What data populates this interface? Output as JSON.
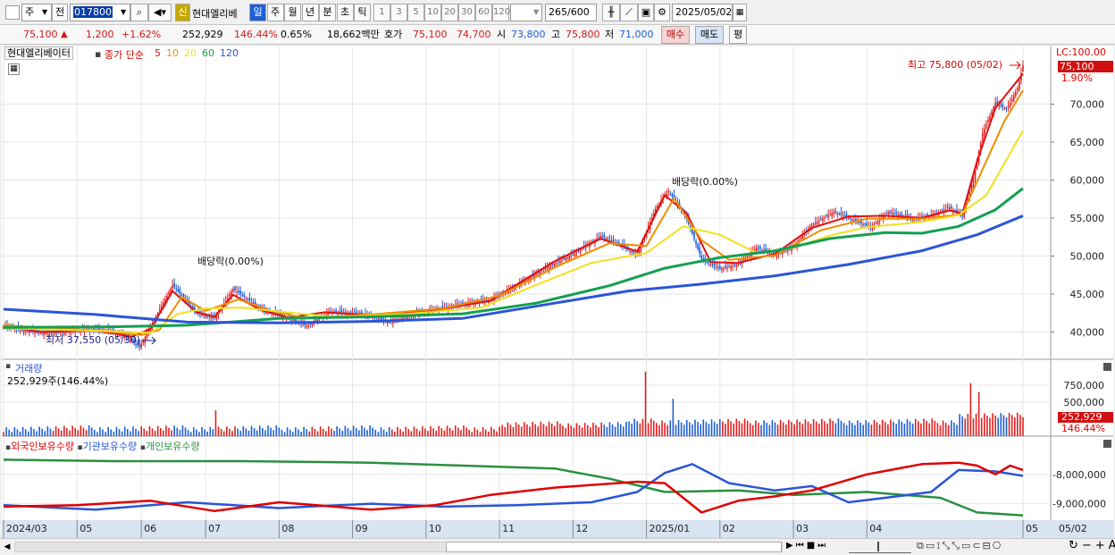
{
  "toolbar": {
    "period_type": "주",
    "prev_label": "전",
    "stock_code": "017800",
    "new_badge": "신",
    "stock_name": "현대엘리베",
    "intervals": [
      "일",
      "주",
      "월",
      "년",
      "분",
      "초",
      "틱"
    ],
    "active_interval": "일",
    "minute_options": [
      "1",
      "3",
      "5",
      "10",
      "20",
      "30",
      "60",
      "120"
    ],
    "count_value": "265",
    "count_total": "/600",
    "date_value": "2025/05/02"
  },
  "quote": {
    "price": "75,100",
    "change": "1,200",
    "change_pct": "+1.62%",
    "volume": "252,929",
    "volume_ratio": "146.44%",
    "turnover_pct": "0.65%",
    "amount": "18,662백만",
    "ask_label": "호가",
    "ask": "75,100",
    "bid": "74,700",
    "open_label": "시",
    "open": "73,800",
    "high_label": "고",
    "high": "75,800",
    "low_label": "저",
    "low": "71,000",
    "buy_label": "매수",
    "sell_label": "매도",
    "avg_label": "평"
  },
  "colors": {
    "up": "#e02020",
    "down": "#1f5fd6",
    "ma5": "#e01010",
    "ma10": "#f08c00",
    "ma20": "#f0e020",
    "ma60": "#14a050",
    "ma120": "#2a55d8",
    "foreign": "#e00000",
    "inst": "#2a55d8",
    "indiv": "#2a9040"
  },
  "chart_data": [
    {
      "type": "candlestick",
      "title": "현대엘리베이터",
      "legend_title": "종가 단순",
      "legend": [
        "5",
        "10",
        "20",
        "60",
        "120"
      ],
      "lc_label": "LC:100.00",
      "y_ticks": [
        "40,000",
        "45,000",
        "50,000",
        "55,000",
        "60,000",
        "65,000",
        "70,000"
      ],
      "ylim": [
        37000,
        77000
      ],
      "current_price": "75,100",
      "current_pct": "1.90%",
      "annotations": [
        {
          "text": "최고 75,800 (05/02)",
          "value": 75800
        },
        {
          "text": "최저 37,550 (05/30)",
          "value": 37550
        },
        {
          "text": "배당락(0.00%)"
        },
        {
          "text": "배당락(0.00%)"
        }
      ],
      "price_path": [
        [
          0,
          40800
        ],
        [
          10,
          40200
        ],
        [
          25,
          39800
        ],
        [
          45,
          40300
        ],
        [
          58,
          40200
        ],
        [
          68,
          39200
        ],
        [
          74,
          38000
        ],
        [
          80,
          40600
        ],
        [
          92,
          46200
        ],
        [
          105,
          42500
        ],
        [
          115,
          41800
        ],
        [
          125,
          45700
        ],
        [
          140,
          43000
        ],
        [
          155,
          41800
        ],
        [
          165,
          40800
        ],
        [
          178,
          42700
        ],
        [
          195,
          42400
        ],
        [
          210,
          41300
        ],
        [
          225,
          42400
        ],
        [
          245,
          43500
        ],
        [
          265,
          44200
        ],
        [
          280,
          46200
        ],
        [
          295,
          48400
        ],
        [
          310,
          50200
        ],
        [
          325,
          52600
        ],
        [
          335,
          51600
        ],
        [
          345,
          50100
        ],
        [
          355,
          56300
        ],
        [
          362,
          58600
        ],
        [
          372,
          54900
        ],
        [
          380,
          49600
        ],
        [
          390,
          48300
        ],
        [
          400,
          48900
        ],
        [
          410,
          51100
        ],
        [
          420,
          50100
        ],
        [
          430,
          51200
        ],
        [
          440,
          54100
        ],
        [
          452,
          55800
        ],
        [
          462,
          54800
        ],
        [
          472,
          53800
        ],
        [
          482,
          55800
        ],
        [
          495,
          54900
        ],
        [
          505,
          55300
        ],
        [
          515,
          56400
        ],
        [
          522,
          55300
        ],
        [
          528,
          60100
        ],
        [
          533,
          66200
        ],
        [
          540,
          70200
        ],
        [
          546,
          69300
        ],
        [
          552,
          72100
        ],
        [
          555,
          75100
        ]
      ],
      "ma_series": [
        {
          "name": "5",
          "points": [
            [
              0,
              40800
            ],
            [
              20,
              40000
            ],
            [
              50,
              40200
            ],
            [
              70,
              39400
            ],
            [
              80,
              40400
            ],
            [
              92,
              45400
            ],
            [
              105,
              42600
            ],
            [
              115,
              42000
            ],
            [
              125,
              44900
            ],
            [
              140,
              42900
            ],
            [
              155,
              41900
            ],
            [
              175,
              42600
            ],
            [
              200,
              42200
            ],
            [
              230,
              42700
            ],
            [
              265,
              44100
            ],
            [
              300,
              49300
            ],
            [
              325,
              52300
            ],
            [
              345,
              50600
            ],
            [
              360,
              58000
            ],
            [
              372,
              55600
            ],
            [
              385,
              49200
            ],
            [
              400,
              49100
            ],
            [
              420,
              50300
            ],
            [
              440,
              53700
            ],
            [
              460,
              55200
            ],
            [
              480,
              55300
            ],
            [
              500,
              55000
            ],
            [
              515,
              56000
            ],
            [
              522,
              55600
            ],
            [
              530,
              62500
            ],
            [
              540,
              69500
            ],
            [
              555,
              74000
            ]
          ]
        },
        {
          "name": "10",
          "points": [
            [
              0,
              40900
            ],
            [
              50,
              40200
            ],
            [
              75,
              39600
            ],
            [
              85,
              40300
            ],
            [
              97,
              44600
            ],
            [
              110,
              42800
            ],
            [
              128,
              44300
            ],
            [
              145,
              42800
            ],
            [
              165,
              41800
            ],
            [
              200,
              42300
            ],
            [
              240,
              43100
            ],
            [
              270,
              44800
            ],
            [
              300,
              48500
            ],
            [
              330,
              51700
            ],
            [
              350,
              51300
            ],
            [
              365,
              57600
            ],
            [
              380,
              52100
            ],
            [
              395,
              49500
            ],
            [
              420,
              50100
            ],
            [
              445,
              53400
            ],
            [
              470,
              54900
            ],
            [
              500,
              54900
            ],
            [
              522,
              55500
            ],
            [
              535,
              62500
            ],
            [
              545,
              67800
            ],
            [
              555,
              71800
            ]
          ]
        },
        {
          "name": "20",
          "points": [
            [
              0,
              40500
            ],
            [
              60,
              40100
            ],
            [
              80,
              39900
            ],
            [
              95,
              42400
            ],
            [
              110,
              43100
            ],
            [
              130,
              43200
            ],
            [
              150,
              42700
            ],
            [
              180,
              42000
            ],
            [
              220,
              42400
            ],
            [
              260,
              43200
            ],
            [
              290,
              46200
            ],
            [
              320,
              49100
            ],
            [
              350,
              50400
            ],
            [
              370,
              53900
            ],
            [
              390,
              52800
            ],
            [
              410,
              50400
            ],
            [
              430,
              51100
            ],
            [
              450,
              52700
            ],
            [
              470,
              53800
            ],
            [
              500,
              54500
            ],
            [
              520,
              55400
            ],
            [
              535,
              58000
            ],
            [
              555,
              66500
            ]
          ]
        },
        {
          "name": "60",
          "points": [
            [
              0,
              40600
            ],
            [
              60,
              40700
            ],
            [
              100,
              40900
            ],
            [
              150,
              41800
            ],
            [
              200,
              42000
            ],
            [
              250,
              42400
            ],
            [
              290,
              43800
            ],
            [
              330,
              46100
            ],
            [
              360,
              48400
            ],
            [
              390,
              49800
            ],
            [
              420,
              50700
            ],
            [
              450,
              52300
            ],
            [
              480,
              53100
            ],
            [
              500,
              53000
            ],
            [
              520,
              53900
            ],
            [
              540,
              56100
            ],
            [
              555,
              58900
            ]
          ]
        },
        {
          "name": "120",
          "points": [
            [
              0,
              43000
            ],
            [
              50,
              42300
            ],
            [
              100,
              41300
            ],
            [
              150,
              41200
            ],
            [
              200,
              41400
            ],
            [
              250,
              41800
            ],
            [
              300,
              43800
            ],
            [
              340,
              45400
            ],
            [
              380,
              46300
            ],
            [
              420,
              47400
            ],
            [
              460,
              48900
            ],
            [
              500,
              50700
            ],
            [
              530,
              52800
            ],
            [
              555,
              55300
            ]
          ]
        }
      ]
    },
    {
      "type": "bar",
      "title": "거래량",
      "value_text": "252,929주(146.44%)",
      "y_ticks": [
        "750,000",
        "500,000"
      ],
      "ylim": [
        0,
        1000000
      ],
      "current_value": "252,929",
      "current_pct": "146.44%",
      "spikes": [
        {
          "x": 115,
          "v": 380000
        },
        {
          "x": 350,
          "v": 950000
        },
        {
          "x": 364,
          "v": 550000
        },
        {
          "x": 527,
          "v": 780000
        },
        {
          "x": 531,
          "v": 650000
        }
      ]
    },
    {
      "type": "line",
      "series_names": [
        "외국인보유수량",
        "기관보유수량",
        "개인보유수량"
      ],
      "y_ticks": [
        "-8,000,000",
        "-9,000,000"
      ],
      "ylim": [
        -9500000,
        -7000000
      ],
      "x_ticks": [
        "2024/03",
        "05",
        "06",
        "07",
        "08",
        "09",
        "10",
        "11",
        "12",
        "2025/01",
        "02",
        "03",
        "04",
        "05"
      ],
      "end_date": "05/02",
      "foreign": [
        [
          0,
          -9100000
        ],
        [
          40,
          -9050000
        ],
        [
          80,
          -8900000
        ],
        [
          115,
          -9250000
        ],
        [
          150,
          -8950000
        ],
        [
          200,
          -9200000
        ],
        [
          235,
          -9050000
        ],
        [
          265,
          -8700000
        ],
        [
          300,
          -8450000
        ],
        [
          345,
          -8250000
        ],
        [
          360,
          -8300000
        ],
        [
          380,
          -9300000
        ],
        [
          400,
          -8900000
        ],
        [
          420,
          -8750000
        ],
        [
          440,
          -8550000
        ],
        [
          470,
          -8000000
        ],
        [
          500,
          -7650000
        ],
        [
          520,
          -7600000
        ],
        [
          530,
          -7700000
        ],
        [
          540,
          -8000000
        ],
        [
          548,
          -7700000
        ],
        [
          555,
          -7850000
        ]
      ],
      "inst": [
        [
          0,
          -9050000
        ],
        [
          50,
          -9200000
        ],
        [
          100,
          -8950000
        ],
        [
          150,
          -9150000
        ],
        [
          200,
          -9000000
        ],
        [
          240,
          -9100000
        ],
        [
          280,
          -9050000
        ],
        [
          320,
          -8950000
        ],
        [
          345,
          -8600000
        ],
        [
          360,
          -7950000
        ],
        [
          375,
          -7650000
        ],
        [
          395,
          -8300000
        ],
        [
          420,
          -8550000
        ],
        [
          440,
          -8400000
        ],
        [
          460,
          -8950000
        ],
        [
          480,
          -8800000
        ],
        [
          505,
          -8600000
        ],
        [
          520,
          -7850000
        ],
        [
          540,
          -7900000
        ],
        [
          555,
          -8050000
        ]
      ],
      "indiv": [
        [
          0,
          -7500000
        ],
        [
          60,
          -7550000
        ],
        [
          130,
          -7550000
        ],
        [
          200,
          -7600000
        ],
        [
          250,
          -7700000
        ],
        [
          300,
          -7800000
        ],
        [
          330,
          -8150000
        ],
        [
          360,
          -8600000
        ],
        [
          400,
          -8550000
        ],
        [
          430,
          -8700000
        ],
        [
          470,
          -8600000
        ],
        [
          510,
          -8800000
        ],
        [
          530,
          -9300000
        ],
        [
          555,
          -9400000
        ]
      ]
    }
  ]
}
